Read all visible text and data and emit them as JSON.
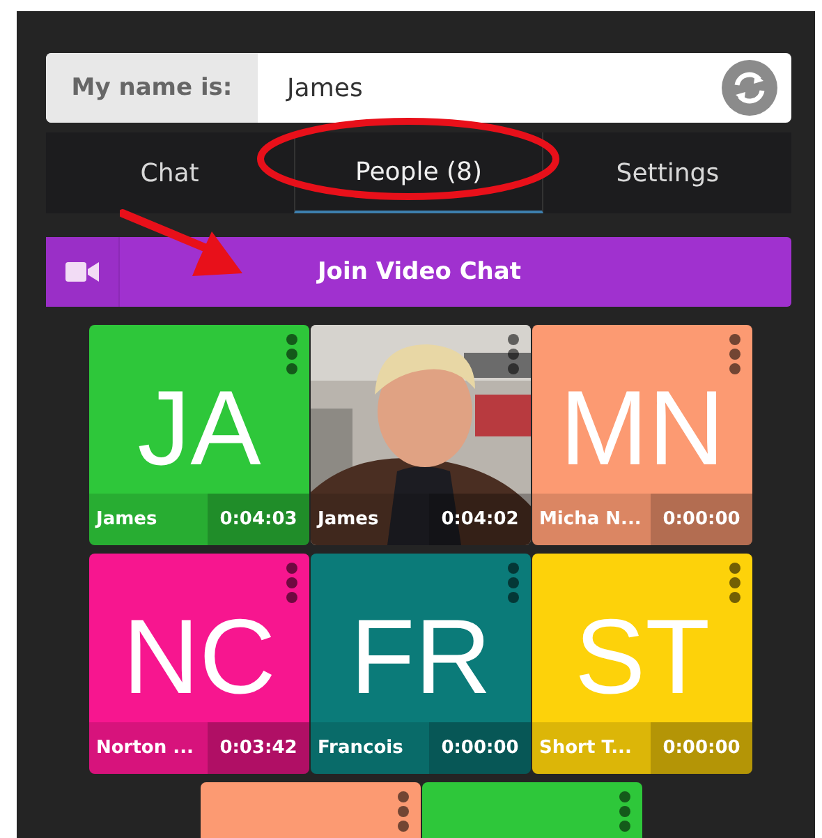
{
  "name_bar": {
    "label": "My name is:",
    "value": "James"
  },
  "tabs": [
    {
      "label": "Chat",
      "selected": false
    },
    {
      "label": "People (8)",
      "selected": true
    },
    {
      "label": "Settings",
      "selected": false
    }
  ],
  "join_button": {
    "label": "Join Video Chat"
  },
  "tiles": [
    {
      "kind": "initials",
      "color": "#2ec73a",
      "initials": "JA",
      "name": "James",
      "time": "0:04:03"
    },
    {
      "name": "James",
      "time": "0:04:02"
    },
    {
      "kind": "initials",
      "color": "#fc9a72",
      "initials": "MN",
      "name": "Micha N...",
      "time": "0:00:00"
    },
    {
      "kind": "initials",
      "color": "#f7168f",
      "initials": "NC",
      "name": "Norton ...",
      "time": "0:03:42"
    },
    {
      "kind": "initials",
      "color": "#0b7b79",
      "initials": "FR",
      "name": "Francois",
      "time": "0:00:00"
    },
    {
      "kind": "initials",
      "color": "#fdd20a",
      "initials": "ST",
      "name": "Short T...",
      "time": "0:00:00"
    },
    {
      "kind": "partial",
      "color": "#fc9a72"
    },
    {
      "kind": "partial",
      "color": "#2ec73a"
    }
  ]
}
